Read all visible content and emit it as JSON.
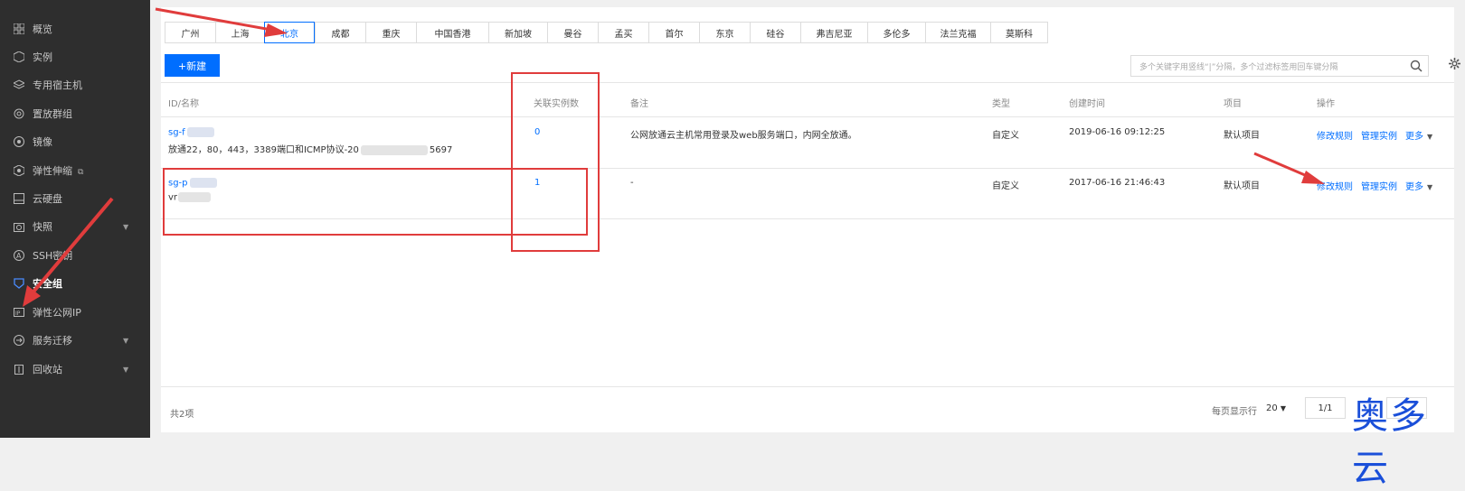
{
  "sidebar": {
    "items": [
      {
        "label": "概览",
        "icon": "grid-icon"
      },
      {
        "label": "实例",
        "icon": "cube-icon"
      },
      {
        "label": "专用宿主机",
        "icon": "layers-icon"
      },
      {
        "label": "置放群组",
        "icon": "gear-cube-icon"
      },
      {
        "label": "镜像",
        "icon": "disc-icon"
      },
      {
        "label": "弹性伸缩",
        "icon": "scale-icon",
        "external": "⧉"
      },
      {
        "label": "云硬盘",
        "icon": "disk-icon"
      },
      {
        "label": "快照",
        "icon": "camera-icon",
        "caret": "▼"
      },
      {
        "label": "SSH密钥",
        "icon": "key-icon"
      },
      {
        "label": "安全组",
        "icon": "shield-icon",
        "active": true
      },
      {
        "label": "弹性公网IP",
        "icon": "eip-icon"
      },
      {
        "label": "服务迁移",
        "icon": "migrate-icon",
        "caret": "▼"
      },
      {
        "label": "回收站",
        "icon": "trash-icon",
        "caret": "▼"
      }
    ]
  },
  "regions": [
    "广州",
    "上海",
    "北京",
    "成都",
    "重庆",
    "中国香港",
    "新加坡",
    "曼谷",
    "孟买",
    "首尔",
    "东京",
    "硅谷",
    "弗吉尼亚",
    "多伦多",
    "法兰克福",
    "莫斯科"
  ],
  "active_region": "北京",
  "toolbar": {
    "new_button": "+新建",
    "search_placeholder": "多个关键字用竖线“|”分隔，多个过滤标签用回车键分隔"
  },
  "table": {
    "headers": {
      "id": "ID/名称",
      "count": "关联实例数",
      "remark": "备注",
      "type": "类型",
      "created": "创建时间",
      "project": "项目",
      "ops": "操作"
    },
    "rows": [
      {
        "id": "sg-f",
        "name_prefix": "放通22，80，443，3389端口和ICMP协议-20",
        "name_suffix": "5697",
        "count": "0",
        "remark": "公网放通云主机常用登录及web服务端口，内网全放通。",
        "type": "自定义",
        "created": "2019-06-16 09:12:25",
        "project": "默认项目"
      },
      {
        "id": "sg-p",
        "name_prefix": "vr",
        "name_suffix": "",
        "count": "1",
        "remark": "-",
        "type": "自定义",
        "created": "2017-06-16 21:46:43",
        "project": "默认项目"
      }
    ],
    "ops": {
      "edit": "修改规则",
      "manage": "管理实例",
      "more": "更多",
      "caret": "▼"
    }
  },
  "footer": {
    "total": "共2项",
    "per_page_label": "每页显示行",
    "per_page_value": "20",
    "per_page_caret": "▼",
    "page": "1/1"
  },
  "watermark": "奥多云",
  "colors": {
    "accent": "#006eff",
    "sidebar_bg": "#2e2e2e",
    "annotation": "#e03c3c"
  }
}
